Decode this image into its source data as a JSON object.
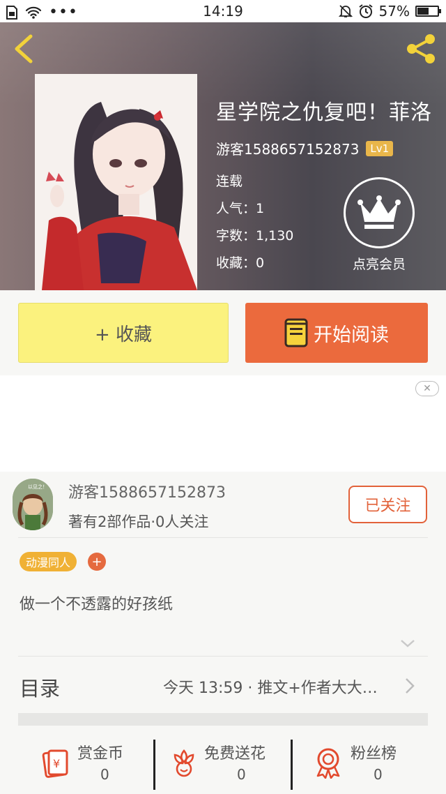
{
  "status_bar": {
    "time": "14:19",
    "battery": "57%",
    "battery_level": 0.57
  },
  "book": {
    "title": "星学院之仇复吧！菲洛",
    "author": "游客1588657152873",
    "level": "Lv1",
    "status": "连载",
    "popularity": "人气：1",
    "word_count": "字数：1,130",
    "favorites": "收藏：0",
    "vip_label": "点亮会员"
  },
  "actions": {
    "collect_label": "+ 收藏",
    "read_label": "开始阅读"
  },
  "ad": {
    "close_symbol": "✕"
  },
  "author_card": {
    "name": "游客1588657152873",
    "stats": "著有2部作品·0人关注",
    "follow_label": "已关注",
    "avatar_caption": "以见之！"
  },
  "tags": {
    "items": [
      "动漫同人"
    ],
    "add_symbol": "+"
  },
  "intro": "做一个不透露的好孩纸",
  "toc": {
    "title": "目录",
    "latest": "今天 13:59 · 推文+作者大大…"
  },
  "bottom_bar": [
    {
      "label": "赏金币",
      "count": "0"
    },
    {
      "label": "免费送花",
      "count": "0"
    },
    {
      "label": "粉丝榜",
      "count": "0"
    }
  ],
  "colors": {
    "accent_orange": "#eb6a3d",
    "collect_yellow": "#fbf27e",
    "tag_yellow": "#f0b135",
    "icon_red": "#e24a2e",
    "level_badge": "#e9b64a"
  }
}
